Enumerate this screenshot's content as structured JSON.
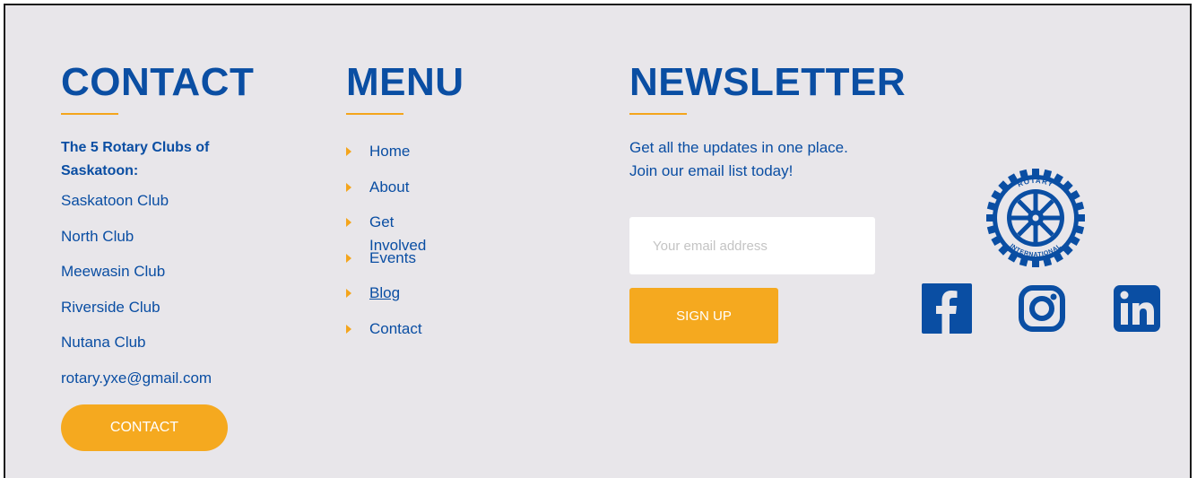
{
  "contact": {
    "heading": "CONTACT",
    "club_title": "The 5 Rotary Clubs of Saskatoon:",
    "items": [
      "Saskatoon Club",
      "North Club",
      "Meewasin Club",
      "Riverside Club",
      "Nutana Club",
      "rotary.yxe@gmail.com"
    ],
    "button_label": "CONTACT"
  },
  "menu": {
    "heading": "MENU",
    "items": [
      "Home",
      "About",
      "Get Involved",
      "Events",
      "Blog",
      "Contact"
    ]
  },
  "newsletter": {
    "heading": "NEWSLETTER",
    "description": "Get all the updates in one place. Join our email list today!",
    "email_placeholder": "Your email address",
    "signup_label": "SIGN UP"
  },
  "logo": {
    "ring_text_top": "ROTARY",
    "ring_text_bottom": "INTERNATIONAL",
    "icon": "rotary-wheel-logo"
  },
  "social": [
    "facebook-icon",
    "instagram-icon",
    "linkedin-icon"
  ],
  "colors": {
    "brand_blue": "#0a4ea3",
    "accent_gold": "#f4a51c",
    "background": "#e8e6ea"
  }
}
